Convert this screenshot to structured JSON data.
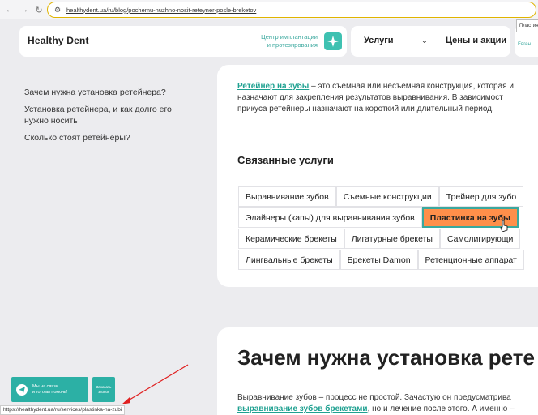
{
  "browser": {
    "url": "healthydent.ua/ru/blog/pochemu-nuzhno-nosit-reteyner-posle-breketov"
  },
  "header": {
    "logo": "Healthy Dent",
    "center_line1": "Центр имплантации",
    "center_line2": "и протезирования",
    "services_label": "Услуги",
    "prices_label": "Цены и акции",
    "right_stub_text": "Евген",
    "tooltip": "Пластин"
  },
  "sidebar": {
    "items": [
      "Зачем нужна установка ретейнера?",
      "Установка ретейнера, и как долго его нужно носить",
      "Сколько стоят ретейнеры?"
    ]
  },
  "article": {
    "para_link": "Ретейнер на зубы",
    "para_line1_rest": " – это съемная или несъемная конструкция, которая и",
    "para_line2": "назначают для закрепления результатов выравнивания. В зависимост",
    "para_line3": "прикуса ретейнеры назначают на короткий или длительный период.",
    "related_title": "Связанные услуги",
    "tags": [
      [
        "Выравнивание зубов",
        "Съемные конструкции",
        "Трейнер для зубо"
      ],
      [
        "Элайнеры (капы) для выравнивания зубов",
        "Пластинка на зубы"
      ],
      [
        "Керамические брекеты",
        "Лигатурные брекеты",
        "Самолигирующи"
      ],
      [
        "Лингвальные брекеты",
        "Брекеты Damon",
        "Ретенционные аппарат"
      ]
    ],
    "h2": "Зачем нужна установка рете",
    "para2_line1": "Выравнивание зубов – процесс не простой. Зачастую он предусматрива",
    "para2_link": "выравнивание зубов брекетами",
    "para2_line2_rest": ", но и лечение после этого. А именно –"
  },
  "chat": {
    "text_line1": "Мы на связи",
    "text_line2": "и готовы помочь!",
    "call_line1": "Заказать",
    "call_line2": "звонок"
  },
  "status_url": "https://healthydent.ua/ru/services/plastinka-na-zubi"
}
